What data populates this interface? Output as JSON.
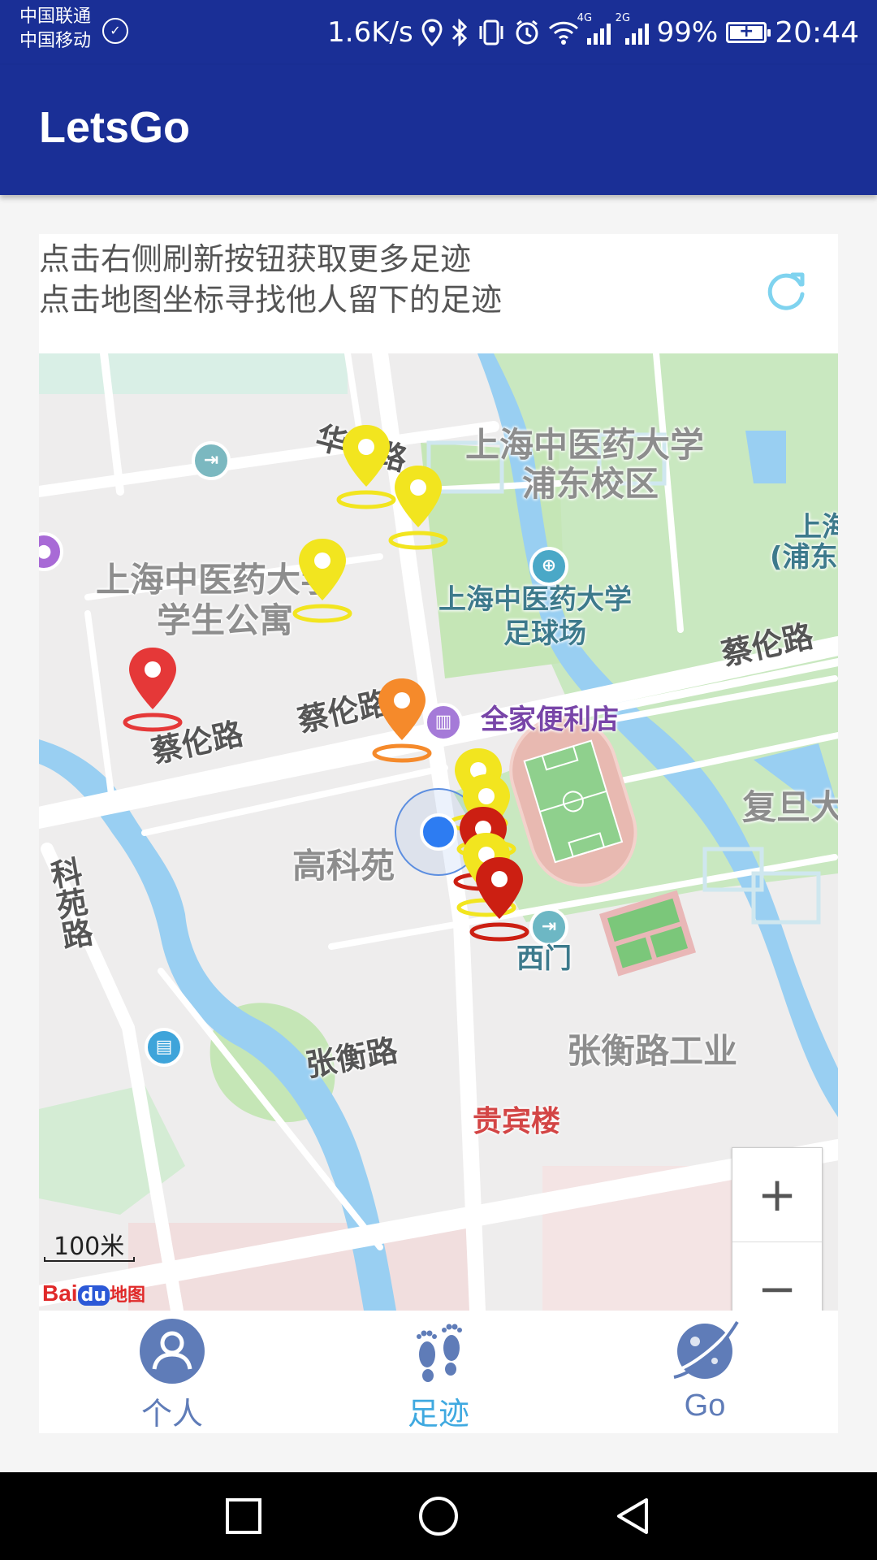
{
  "status_bar": {
    "carrier_1": "中国联通",
    "carrier_2": "中国移动",
    "speed": "1.6K/s",
    "network_4g": "4G",
    "network_2g": "2G",
    "battery": "99%",
    "time": "20:44"
  },
  "app_bar": {
    "title": "LetsGo"
  },
  "hint": {
    "line1": "点击右侧刷新按钮获取更多足迹",
    "line2": "点击地图坐标寻找他人留下的足迹"
  },
  "map": {
    "labels": {
      "campus": "上海中医药大学",
      "campus_sub": "浦东校区",
      "campus_right_1": "上海",
      "campus_right_2": "(浦东",
      "dorm_1": "上海中医药大学",
      "dorm_2": "学生公寓",
      "field_1": "上海中医药大学",
      "field_2": "足球场",
      "road_hua": "华佗路",
      "road_cailun_1": "蔡伦路",
      "road_cailun_2": "蔡伦路",
      "road_cailun_3": "蔡伦路",
      "road_keyuan": "科苑路",
      "road_zhangheng": "张衡路",
      "zhangheng_ind": "张衡路工业",
      "gaokeyuan": "高科苑",
      "fudan": "复旦大",
      "west_gate": "西门",
      "shop": "全家便利店",
      "guibin": "贵宾楼"
    },
    "scale": "100米",
    "logo": {
      "bai": "Bai",
      "du": "du",
      "map": "地图"
    },
    "zoom_in": "+",
    "zoom_out": "−",
    "colors": {
      "pin_yellow": "#f2e51f",
      "pin_red": "#e53838",
      "pin_orange": "#f58a2b",
      "pin_dark_red": "#cc1f12"
    }
  },
  "bottom_nav": {
    "items": [
      {
        "label": "个人",
        "icon": "person-icon"
      },
      {
        "label": "足迹",
        "icon": "footprints-icon",
        "active": true
      },
      {
        "label": "Go",
        "icon": "planet-icon"
      }
    ],
    "active_color": "#3fa9e0",
    "inactive_color": "#5f7cb8"
  }
}
